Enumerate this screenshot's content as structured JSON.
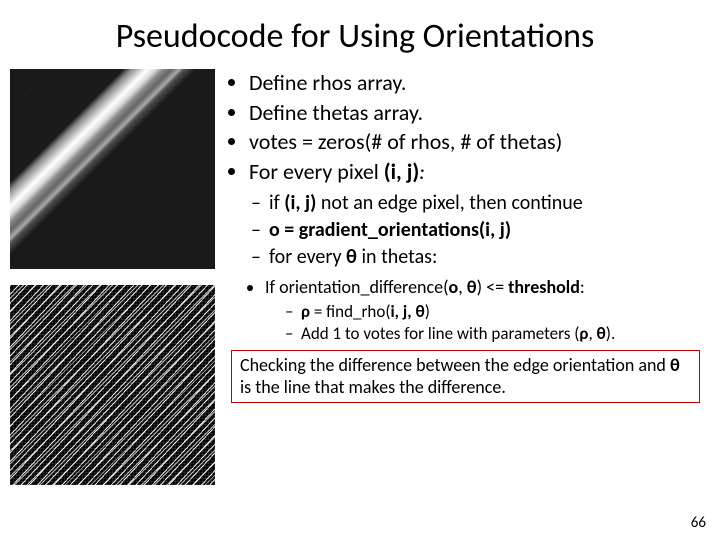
{
  "title": "Pseudocode for Using Orientations",
  "bullets": {
    "b1": "Define rhos array.",
    "b2": "Define thetas array.",
    "b3": "votes = zeros(# of rhos, # of thetas)",
    "b4_pre": "For every pixel ",
    "b4_ij": "(i, j)",
    "b4_post": ":"
  },
  "sub": {
    "s1_pre": "if ",
    "s1_ij": "(i, j)",
    "s1_post": " not an edge pixel, then continue",
    "s2": "o = gradient_orientations(i, j)",
    "s3_pre": "for every ",
    "s3_th": "θ",
    "s3_post": " in thetas:"
  },
  "subsub": {
    "c1_pre": "If orientation_difference(",
    "c1_o": "o",
    "c1_mid": ", ",
    "c1_th": "θ",
    "c1_post": ") <= ",
    "c1_thr": "threshold",
    "c1_end": ":",
    "d1_rho": "ρ",
    "d1_eq": " = find_rho(",
    "d1_args": "i, j, θ",
    "d1_close": ")",
    "d2_pre": "Add 1 to votes for line with parameters (",
    "d2_rho": "ρ",
    "d2_mid": ", ",
    "d2_th": "θ",
    "d2_post": ")."
  },
  "callout": {
    "pre": "Checking the difference between the edge orientation and ",
    "th": "θ",
    "post": " is the line that makes the difference."
  },
  "page_number": "66"
}
